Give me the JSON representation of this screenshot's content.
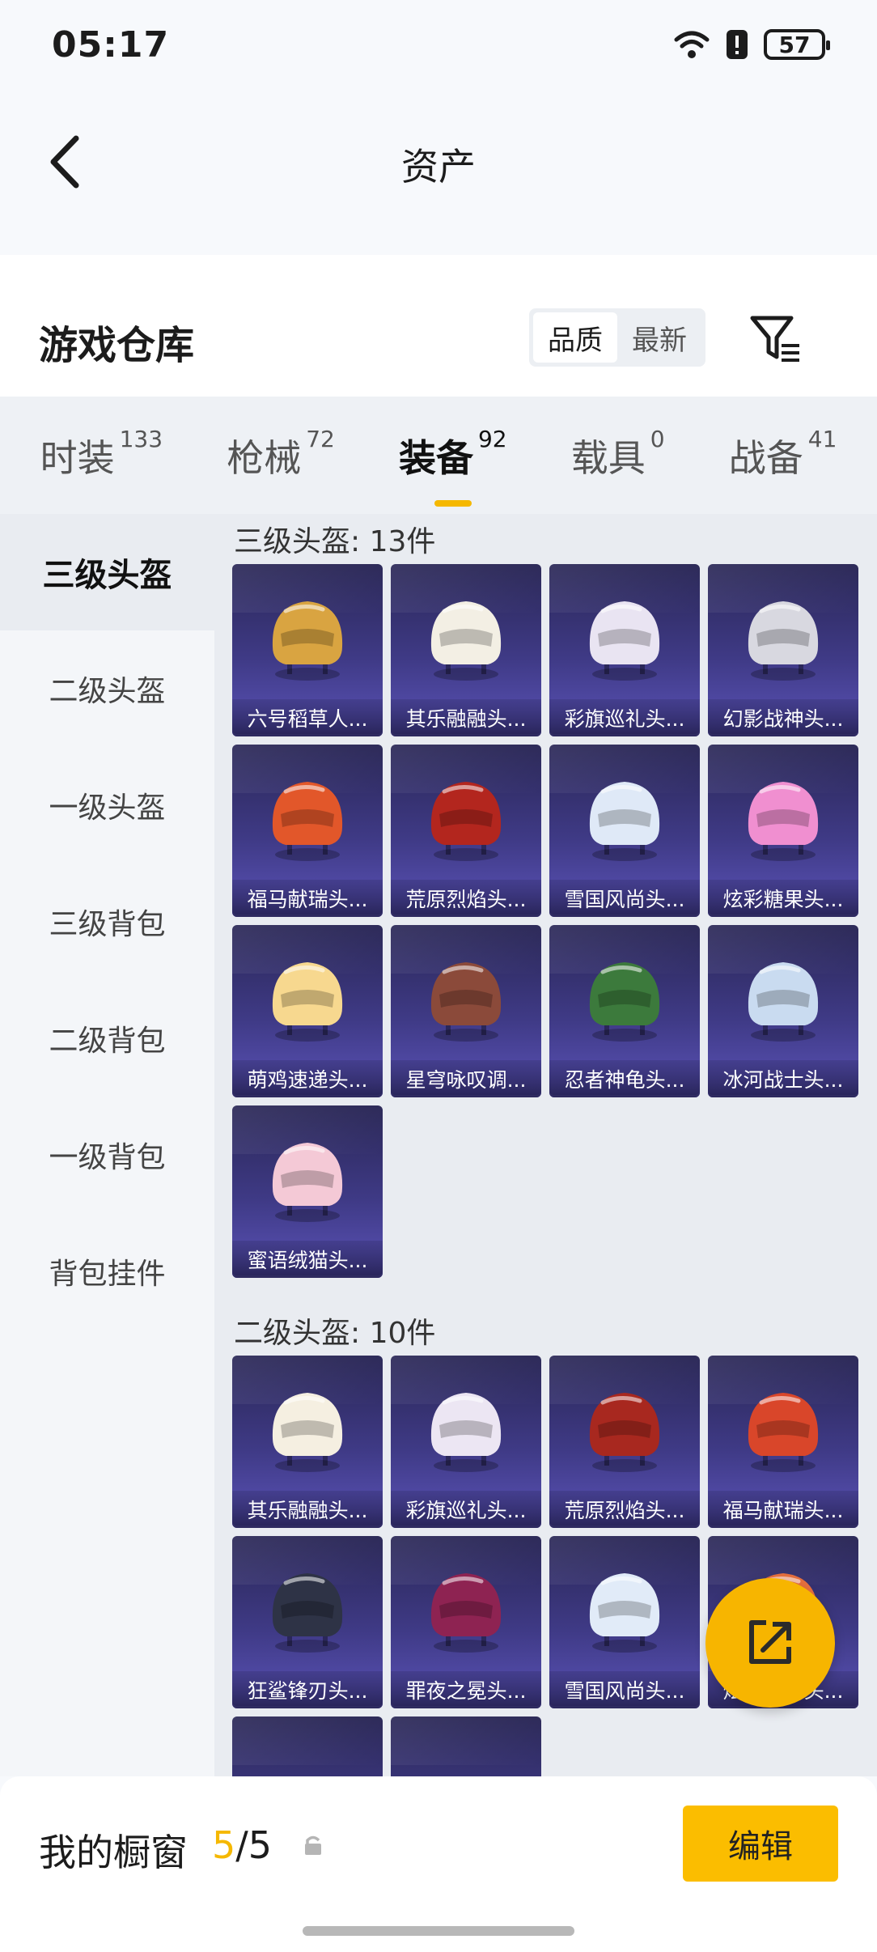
{
  "status_bar": {
    "time": "05:17",
    "battery": "57"
  },
  "header": {
    "title": "资产"
  },
  "section": {
    "title": "游戏仓库",
    "sort_options": [
      "品质",
      "最新"
    ],
    "active_sort": "品质"
  },
  "tabs": [
    {
      "label": "时装",
      "count": "133"
    },
    {
      "label": "枪械",
      "count": "72"
    },
    {
      "label": "装备",
      "count": "92"
    },
    {
      "label": "载具",
      "count": "0"
    },
    {
      "label": "战备",
      "count": "41"
    }
  ],
  "sidebar": [
    "三级头盔",
    "二级头盔",
    "一级头盔",
    "三级背包",
    "二级背包",
    "一级背包",
    "背包挂件"
  ],
  "groups": [
    {
      "title": "三级头盔: 13件",
      "items": [
        {
          "name": "六号稻草人...",
          "color": "#d9a441"
        },
        {
          "name": "其乐融融头...",
          "color": "#f3efe4"
        },
        {
          "name": "彩旗巡礼头...",
          "color": "#e9e4f2"
        },
        {
          "name": "幻影战神头...",
          "color": "#d8d8e0"
        },
        {
          "name": "福马献瑞头...",
          "color": "#e2572a"
        },
        {
          "name": "荒原烈焰头...",
          "color": "#b3261e"
        },
        {
          "name": "雪国风尚头...",
          "color": "#dfe9f7"
        },
        {
          "name": "炫彩糖果头...",
          "color": "#f08fd0"
        },
        {
          "name": "萌鸡速递头...",
          "color": "#f7d88f"
        },
        {
          "name": "星穹咏叹调...",
          "color": "#8b4a3a"
        },
        {
          "name": "忍者神龟头...",
          "color": "#3c7a3c"
        },
        {
          "name": "冰河战士头...",
          "color": "#c9dbf0"
        },
        {
          "name": "蜜语绒猫头...",
          "color": "#f4c9d6"
        }
      ]
    },
    {
      "title": "二级头盔: 10件",
      "items": [
        {
          "name": "其乐融融头...",
          "color": "#f5efe1"
        },
        {
          "name": "彩旗巡礼头...",
          "color": "#ece6f3"
        },
        {
          "name": "荒原烈焰头...",
          "color": "#a8281f"
        },
        {
          "name": "福马献瑞头...",
          "color": "#d9462a"
        },
        {
          "name": "狂鲨锋刃头...",
          "color": "#2e3346"
        },
        {
          "name": "罪夜之冕头...",
          "color": "#8e2352"
        },
        {
          "name": "雪国风尚头...",
          "color": "#e1ebf8"
        },
        {
          "name": "炫彩糖果头...",
          "color": "#e56f3e"
        },
        {
          "name": "",
          "color": ""
        },
        {
          "name": "",
          "color": ""
        }
      ]
    }
  ],
  "bottom_bar": {
    "label": "我的橱窗",
    "count_current": "5",
    "count_total": "/5",
    "edit_label": "编辑"
  }
}
